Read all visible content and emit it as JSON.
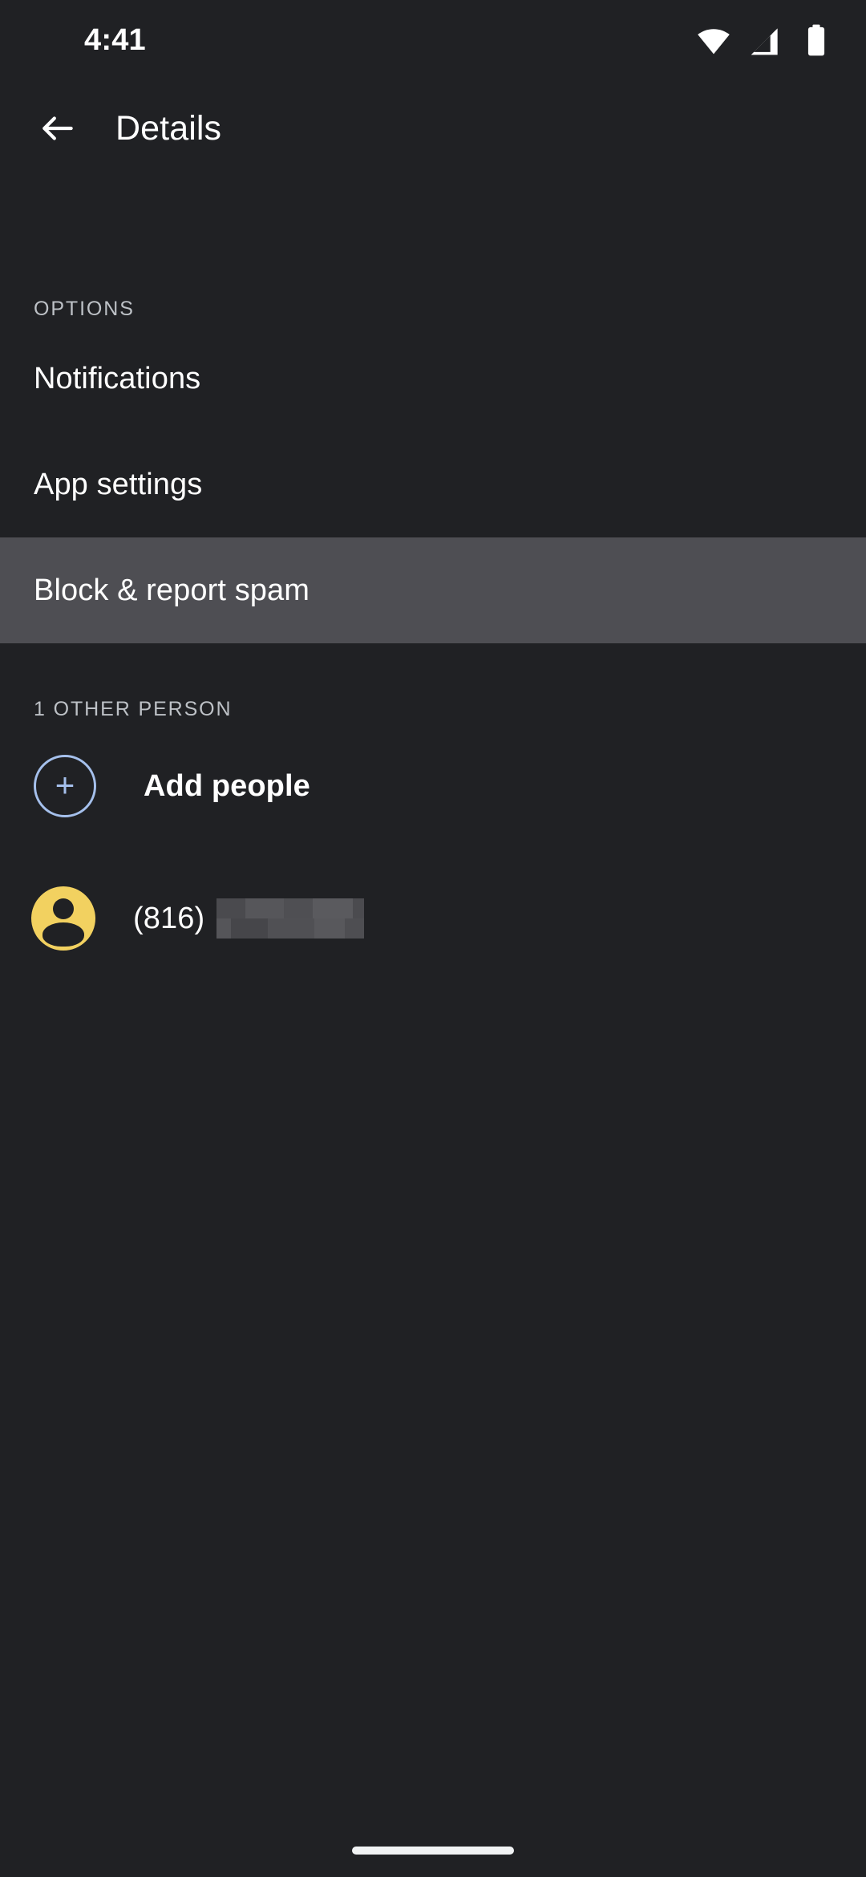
{
  "status_bar": {
    "clock": "4:41",
    "icons": [
      {
        "name": "wifi-icon",
        "label": "Wi-Fi full signal"
      },
      {
        "name": "cellular-signal-icon",
        "label": "Cellular signal"
      },
      {
        "name": "battery-icon",
        "label": "Battery full"
      }
    ]
  },
  "app_bar": {
    "back_icon": "back-arrow-icon",
    "title": "Details"
  },
  "options": {
    "header": "OPTIONS",
    "items": [
      {
        "label": "Notifications",
        "selected": false
      },
      {
        "label": "App settings",
        "selected": false
      },
      {
        "label": "Block & report spam",
        "selected": true
      }
    ]
  },
  "people": {
    "header": "1 OTHER PERSON",
    "add_people": {
      "icon": "plus-icon",
      "label": "Add people"
    },
    "contacts": [
      {
        "avatar_icon": "person-avatar-icon",
        "name": "(816)",
        "redacted": true
      }
    ]
  },
  "nav_bar": {
    "handle": "gesture-nav-pill"
  },
  "colors": {
    "background": "#202124",
    "row_selected": "#4e4e53",
    "text_primary": "#ffffff",
    "text_secondary": "#bdc1c6",
    "accent_blue": "#a5c0ec",
    "avatar_yellow": "#f2d160"
  }
}
